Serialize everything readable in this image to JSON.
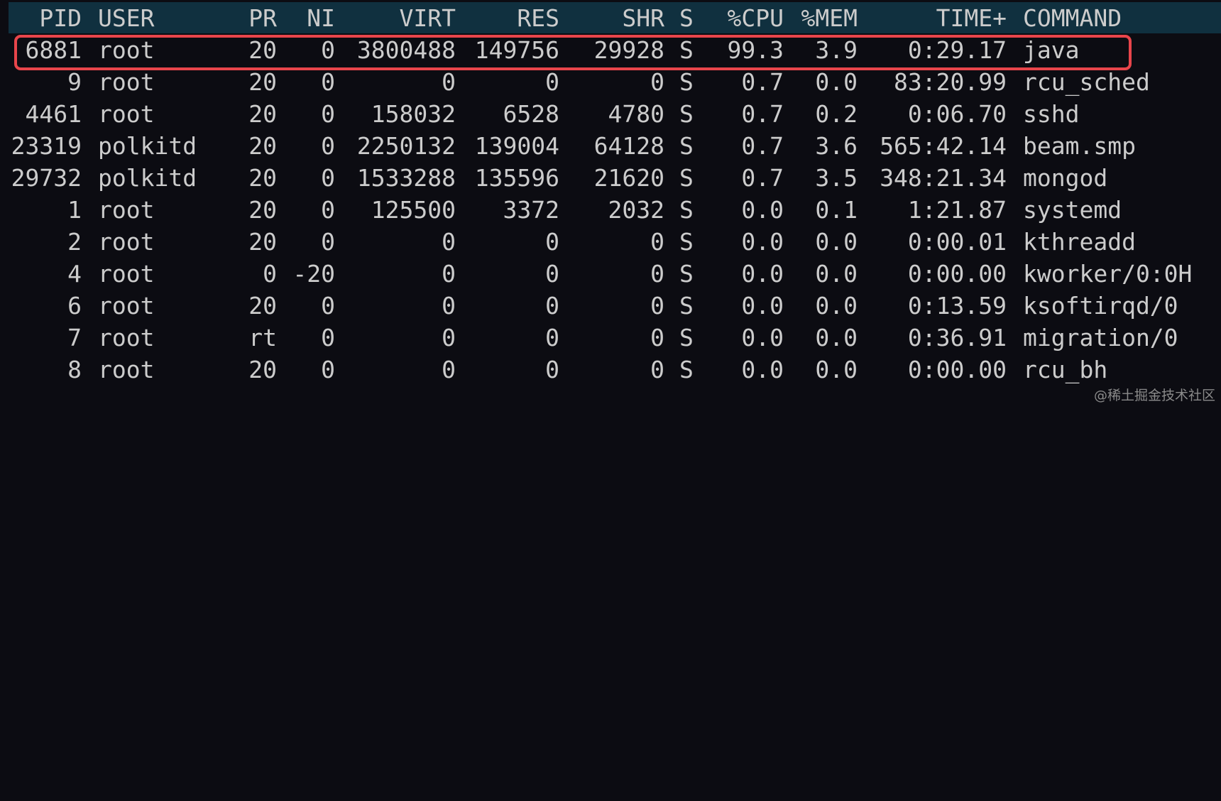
{
  "colors": {
    "background": "#0c0c12",
    "header_background": "#10303f",
    "text": "#cccccc",
    "highlight_border": "#e8454b"
  },
  "table": {
    "columns": [
      "PID",
      "USER",
      "PR",
      "NI",
      "VIRT",
      "RES",
      "SHR",
      "S",
      "%CPU",
      "%MEM",
      "TIME+",
      "COMMAND"
    ],
    "rows": [
      [
        "6881",
        "root",
        "20",
        "0",
        "3800488",
        "149756",
        "29928",
        "S",
        "99.3",
        "3.9",
        "0:29.17",
        "java"
      ],
      [
        "9",
        "root",
        "20",
        "0",
        "0",
        "0",
        "0",
        "S",
        "0.7",
        "0.0",
        "83:20.99",
        "rcu_sched"
      ],
      [
        "4461",
        "root",
        "20",
        "0",
        "158032",
        "6528",
        "4780",
        "S",
        "0.7",
        "0.2",
        "0:06.70",
        "sshd"
      ],
      [
        "23319",
        "polkitd",
        "20",
        "0",
        "2250132",
        "139004",
        "64128",
        "S",
        "0.7",
        "3.6",
        "565:42.14",
        "beam.smp"
      ],
      [
        "29732",
        "polkitd",
        "20",
        "0",
        "1533288",
        "135596",
        "21620",
        "S",
        "0.7",
        "3.5",
        "348:21.34",
        "mongod"
      ],
      [
        "1",
        "root",
        "20",
        "0",
        "125500",
        "3372",
        "2032",
        "S",
        "0.0",
        "0.1",
        "1:21.87",
        "systemd"
      ],
      [
        "2",
        "root",
        "20",
        "0",
        "0",
        "0",
        "0",
        "S",
        "0.0",
        "0.0",
        "0:00.01",
        "kthreadd"
      ],
      [
        "4",
        "root",
        "0",
        "-20",
        "0",
        "0",
        "0",
        "S",
        "0.0",
        "0.0",
        "0:00.00",
        "kworker/0:0H"
      ],
      [
        "6",
        "root",
        "20",
        "0",
        "0",
        "0",
        "0",
        "S",
        "0.0",
        "0.0",
        "0:13.59",
        "ksoftirqd/0"
      ],
      [
        "7",
        "root",
        "rt",
        "0",
        "0",
        "0",
        "0",
        "S",
        "0.0",
        "0.0",
        "0:36.91",
        "migration/0"
      ],
      [
        "8",
        "root",
        "20",
        "0",
        "0",
        "0",
        "0",
        "S",
        "0.0",
        "0.0",
        "0:00.00",
        "rcu_bh"
      ]
    ]
  },
  "watermark": "@稀土掘金技术社区"
}
